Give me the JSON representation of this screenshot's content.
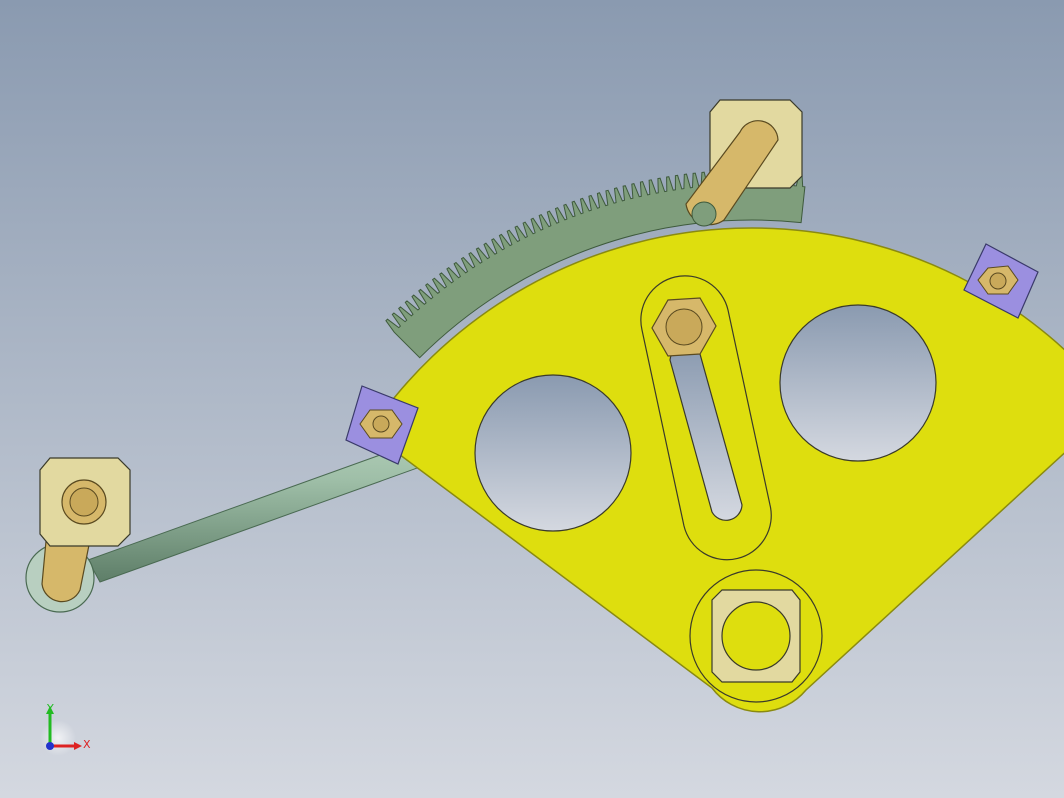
{
  "viewport": {
    "background_top": "#8a9ab0",
    "background_bottom": "#d4d8e0"
  },
  "colors": {
    "sector_plate": "#dede0e",
    "sector_edge": "#8a8a10",
    "gear_rack": "#7f9e7c",
    "gear_rack_edge": "#3e5a3c",
    "rod": "#9fbfa8",
    "brass": "#d6b86a",
    "brass_light": "#e8dba6",
    "block_violet": "#9b8fe0",
    "outline": "#3a3a2a"
  },
  "triad": {
    "y_label": "Y",
    "x_label": "X",
    "y_color": "#22bb22",
    "x_color": "#dd2222",
    "z_color": "#2233cc"
  }
}
